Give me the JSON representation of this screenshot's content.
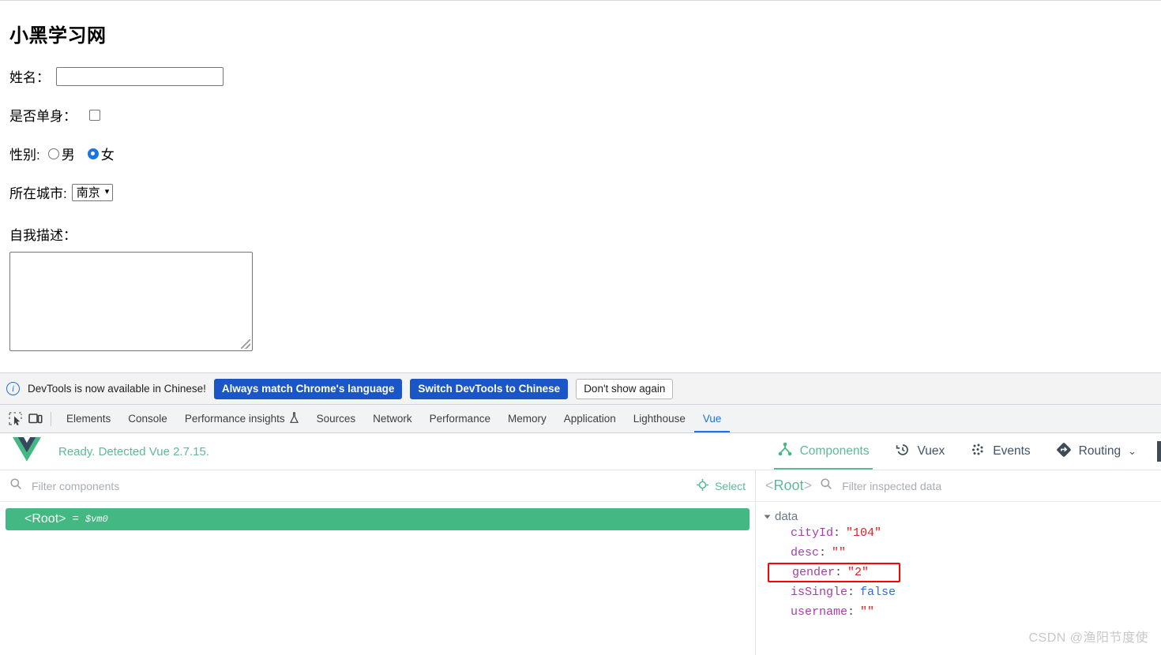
{
  "page": {
    "title": "小黑学习网",
    "fields": {
      "username_label": "姓名：",
      "username_value": "",
      "is_single_label": "是否单身：",
      "is_single_checked": false,
      "gender_label": "性别:",
      "gender_male": "男",
      "gender_female": "女",
      "gender_selected": "女",
      "city_label": "所在城市:",
      "city_value": "南京",
      "desc_label": "自我描述：",
      "desc_value": ""
    }
  },
  "banner": {
    "icon": "info-icon",
    "message": "DevTools is now available in Chinese!",
    "always_match_label": "Always match Chrome's language",
    "switch_label": "Switch DevTools to Chinese",
    "dismiss_label": "Don't show again"
  },
  "devtools": {
    "inspect_icon": "inspect-element-icon",
    "device_icon": "device-toolbar-icon",
    "tabs": [
      {
        "label": "Elements",
        "active": false
      },
      {
        "label": "Console",
        "active": false
      },
      {
        "label": "Performance insights",
        "active": false,
        "icon": "flask-icon"
      },
      {
        "label": "Sources",
        "active": false
      },
      {
        "label": "Network",
        "active": false
      },
      {
        "label": "Performance",
        "active": false
      },
      {
        "label": "Memory",
        "active": false
      },
      {
        "label": "Application",
        "active": false
      },
      {
        "label": "Lighthouse",
        "active": false
      },
      {
        "label": "Vue",
        "active": true
      }
    ]
  },
  "vue": {
    "logo": "vue-logo-icon",
    "status": "Ready. Detected Vue 2.7.15.",
    "nav": [
      {
        "label": "Components",
        "icon": "components-icon",
        "active": true
      },
      {
        "label": "Vuex",
        "icon": "vuex-history-icon",
        "active": false
      },
      {
        "label": "Events",
        "icon": "events-dots-icon",
        "active": false
      },
      {
        "label": "Routing",
        "icon": "routing-diamond-icon",
        "active": false
      }
    ],
    "routing_chevron": "⌄",
    "components_panel": {
      "filter_placeholder": "Filter components",
      "filter_value": "",
      "select_label": "Select",
      "select_icon": "crosshair-icon",
      "tree": [
        {
          "open": "<",
          "name": "Root",
          "close": ">",
          "eq": "=",
          "vm": "$vm0",
          "selected": true
        }
      ]
    },
    "inspector_panel": {
      "root_open": "<",
      "root_name": "Root",
      "root_close": ">",
      "search_icon": "search-icon",
      "filter_placeholder": "Filter inspected data",
      "filter_value": "",
      "section_label": "data",
      "entries": [
        {
          "key": "cityId",
          "value": "\"104\"",
          "type": "string",
          "highlighted": false
        },
        {
          "key": "desc",
          "value": "\"\"",
          "type": "string",
          "highlighted": false
        },
        {
          "key": "gender",
          "value": "\"2\"",
          "type": "string",
          "highlighted": true
        },
        {
          "key": "isSingle",
          "value": "false",
          "type": "boolean",
          "highlighted": false
        },
        {
          "key": "username",
          "value": "\"\"",
          "type": "string",
          "highlighted": false
        }
      ]
    }
  },
  "watermark": "CSDN @渔阳节度使",
  "colors": {
    "vue_green": "#42b883",
    "devtools_blue": "#1a73e8",
    "highlight_red": "#ff0000",
    "button_blue": "#1a56c7"
  }
}
